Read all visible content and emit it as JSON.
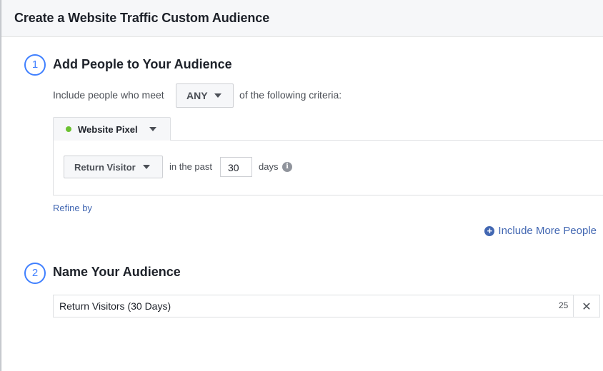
{
  "modal": {
    "title": "Create a Website Traffic Custom Audience"
  },
  "step1": {
    "number": "1",
    "title": "Add People to Your Audience",
    "criteria_prefix": "Include people who meet",
    "match_value": "ANY",
    "criteria_suffix": "of the following criteria:",
    "source_tab": "Website Pixel",
    "visitor_rule": "Return Visitor",
    "in_the_past": "in the past",
    "days_value": "30",
    "days_label": "days",
    "info_icon": "i",
    "refine_link": "Refine by",
    "include_more": "Include More People"
  },
  "step2": {
    "number": "2",
    "title": "Name Your Audience",
    "audience_name": "Return Visitors (30 Days)",
    "char_count": "25",
    "clear_icon": "✕"
  },
  "colors": {
    "accent_blue": "#4080ff",
    "link_blue": "#4267b2",
    "pixel_green": "#6bc131"
  }
}
